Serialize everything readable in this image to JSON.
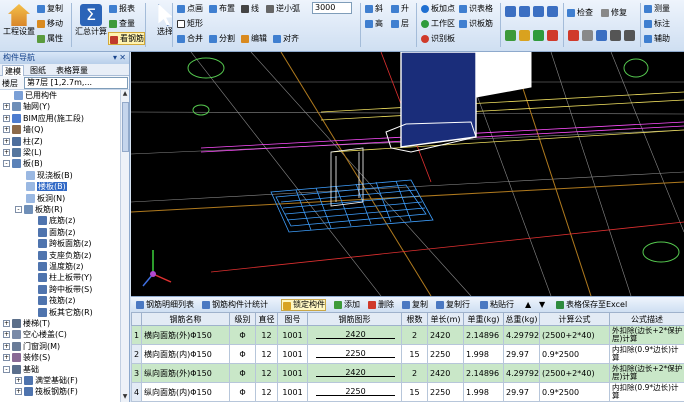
{
  "ribbon": {
    "project_settings": "工程设置",
    "copy": "复制",
    "move": "移动",
    "properties": "属性",
    "summary_calc": "汇总计算",
    "report": "报表",
    "check_quantity": "查量",
    "view_rebar": "看钢筋",
    "select": "选择",
    "point": "点画",
    "place": "布置",
    "line": "线",
    "rectangle": "矩形",
    "merge": "合并",
    "split": "分割",
    "edit": "编辑",
    "align": "对齐",
    "slope": "斜",
    "rise": "升",
    "hide": "高",
    "plan": "层",
    "slab_point": "板加点",
    "work_area": "工作区",
    "identify": "识别板",
    "identify_table": "识表格",
    "identify_rebar": "识板筋",
    "check": "检查",
    "modify": "修复",
    "dims": "测量",
    "annotate": "标注",
    "aux": "辅助",
    "combo_value": "3000",
    "combo_counter": "逆小弧"
  },
  "nav": {
    "title": "构件导航",
    "tabs": [
      "建模",
      "图纸",
      "表格算量"
    ],
    "floor_label": "楼层",
    "floor_value": "第7层 [1,2.7m,..."
  },
  "tree": [
    {
      "label": "已用构件",
      "indent": 0,
      "color": "#7a9fd6",
      "expander": ""
    },
    {
      "label": "轴网(Y)",
      "indent": 0,
      "color": "#6f8fb8",
      "expander": "+"
    },
    {
      "label": "BIM应用(施工段)",
      "indent": 0,
      "color": "#4d7ccf",
      "expander": "+"
    },
    {
      "label": "墙(Q)",
      "indent": 0,
      "color": "#8c6a4a",
      "expander": "+"
    },
    {
      "label": "柱(Z)",
      "indent": 0,
      "color": "#4e6e9c",
      "expander": "+"
    },
    {
      "label": "梁(L)",
      "indent": 0,
      "color": "#56779f",
      "expander": "+"
    },
    {
      "label": "板(B)",
      "indent": 0,
      "color": "#5b82b8",
      "expander": "-"
    },
    {
      "label": "现浇板(B)",
      "indent": 1,
      "color": "#9ab8e2",
      "expander": ""
    },
    {
      "label": "楼板(B)",
      "indent": 1,
      "color": "#9ab8e2",
      "expander": "",
      "selected": true
    },
    {
      "label": "板洞(N)",
      "indent": 1,
      "color": "#9ab8e2",
      "expander": ""
    },
    {
      "label": "板筋(R)",
      "indent": 1,
      "color": "#6f8fb8",
      "expander": "-"
    },
    {
      "label": "底筋(z)",
      "indent": 2,
      "color": "#4f74ae",
      "expander": ""
    },
    {
      "label": "面筋(z)",
      "indent": 2,
      "color": "#4f74ae",
      "expander": ""
    },
    {
      "label": "跨板面筋(z)",
      "indent": 2,
      "color": "#4f74ae",
      "expander": ""
    },
    {
      "label": "支座负筋(z)",
      "indent": 2,
      "color": "#4f74ae",
      "expander": ""
    },
    {
      "label": "温度筋(z)",
      "indent": 2,
      "color": "#4f74ae",
      "expander": ""
    },
    {
      "label": "柱上板带(Y)",
      "indent": 2,
      "color": "#4f74ae",
      "expander": ""
    },
    {
      "label": "跨中板带(S)",
      "indent": 2,
      "color": "#4f74ae",
      "expander": ""
    },
    {
      "label": "筏筋(z)",
      "indent": 2,
      "color": "#4f74ae",
      "expander": ""
    },
    {
      "label": "板其它筋(R)",
      "indent": 2,
      "color": "#4f74ae",
      "expander": ""
    },
    {
      "label": "楼梯(T)",
      "indent": 0,
      "color": "#5c6f8a",
      "expander": "+"
    },
    {
      "label": "空心楼盖(C)",
      "indent": 0,
      "color": "#7a8aa8",
      "expander": "+"
    },
    {
      "label": "门窗洞(M)",
      "indent": 0,
      "color": "#6a7c98",
      "expander": "+"
    },
    {
      "label": "装修(S)",
      "indent": 0,
      "color": "#8a6a96",
      "expander": "+"
    },
    {
      "label": "基础",
      "indent": 0,
      "color": "#5a6e8c",
      "expander": "-"
    },
    {
      "label": "满堂基础(F)",
      "indent": 1,
      "color": "#4f74ae",
      "expander": "+"
    },
    {
      "label": "筏板钢筋(F)",
      "indent": 1,
      "color": "#4f74ae",
      "expander": "+"
    }
  ],
  "grid_toolbar": {
    "tab1": "钢筋明细列表",
    "tab2": "钢筋构件计统计",
    "lock": "锁定构件",
    "add": "添加",
    "delete": "删除",
    "copy": "复制",
    "copy_row": "复制行",
    "paste_row": "粘贴行",
    "save_excel": "表格保存至Excel"
  },
  "grid": {
    "columns": [
      "",
      "钢筋名称",
      "级别",
      "直径",
      "图号",
      "钢筋图形",
      "根数",
      "单长(m)",
      "单重(kg)",
      "总重(kg)",
      "计算公式",
      "公式描述"
    ],
    "rows": [
      {
        "no": "1",
        "name": "横向面筋(外)Φ150",
        "grade": "Φ",
        "dia": "12",
        "fig": "1001",
        "shape_len": "2420",
        "count": "2",
        "unit_len": "2420",
        "unit_wt": "2.14896",
        "total_wt": "4.29792",
        "formula": "(2500+2*40)",
        "desc": "外扣除(边长+2*保护层)计算",
        "selected": true
      },
      {
        "no": "2",
        "name": "横向面筋(内)Φ150",
        "grade": "Φ",
        "dia": "12",
        "fig": "1001",
        "shape_len": "2250",
        "count": "15",
        "unit_len": "2250",
        "unit_wt": "1.998",
        "total_wt": "29.97",
        "formula": "0.9*2500",
        "desc": "内扣除(0.9*边长)计算",
        "selected": false
      },
      {
        "no": "3",
        "name": "纵向面筋(外)Φ150",
        "grade": "Φ",
        "dia": "12",
        "fig": "1001",
        "shape_len": "2420",
        "count": "2",
        "unit_len": "2420",
        "unit_wt": "2.14896",
        "total_wt": "4.29792",
        "formula": "(2500+2*40)",
        "desc": "外扣除(边长+2*保护层)计算",
        "selected": true
      },
      {
        "no": "4",
        "name": "纵向面筋(内)Φ150",
        "grade": "Φ",
        "dia": "12",
        "fig": "1001",
        "shape_len": "2250",
        "count": "15",
        "unit_len": "2250",
        "unit_wt": "1.998",
        "total_wt": "29.97",
        "formula": "0.9*2500",
        "desc": "内扣除(0.9*边长)计算",
        "selected": false
      }
    ]
  },
  "colors": {
    "viewport_bg": "#000000",
    "selected_row": "#c9e7c8",
    "tree_selection": "#3169c6"
  }
}
